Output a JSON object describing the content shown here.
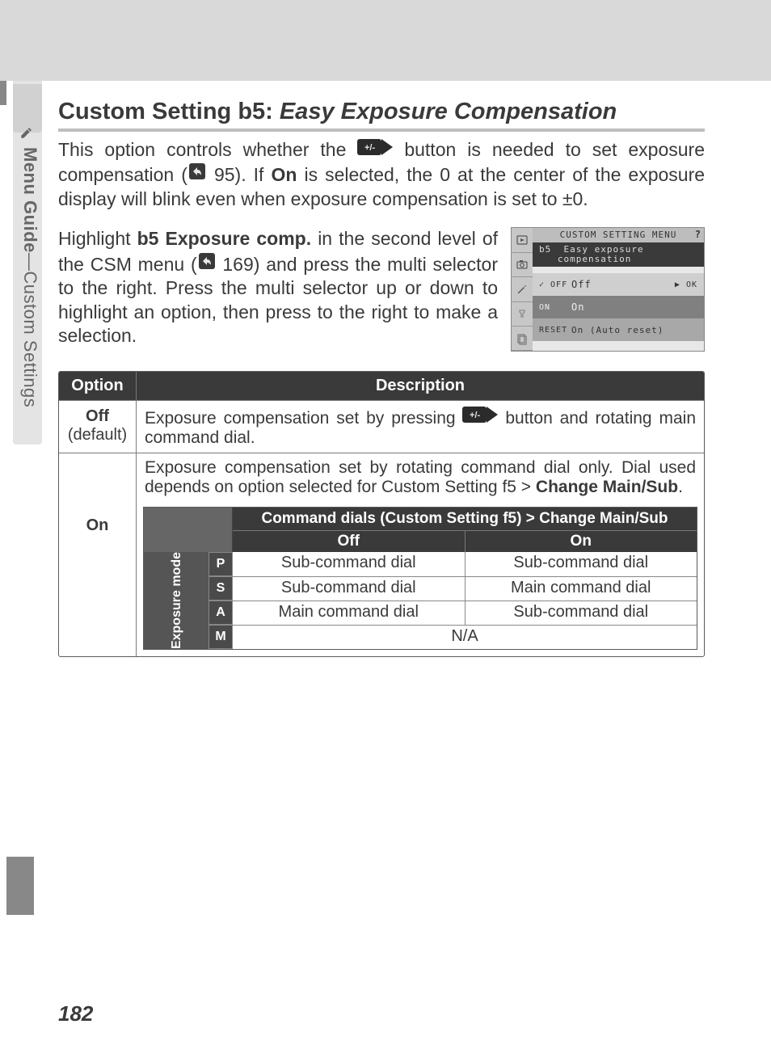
{
  "side_tab": {
    "icon": "pencil-icon",
    "label_bold": "Menu Guide",
    "label_sep": "—",
    "label_rest": "Custom Settings"
  },
  "heading": {
    "lead": "Custom Setting b5:",
    "title": "Easy Exposure Compensation"
  },
  "intro": {
    "p1a": "This option controls whether the",
    "p1b": "button is needed to set exposure compensation (",
    "xref1": "95",
    "p1c": ").  If",
    "p1bold": "On",
    "p1d": "is selected, the 0 at the center of the exposure display will blink even when exposure compensation is set to ±0."
  },
  "para2": {
    "a": "Highlight",
    "bold": "b5 Exposure comp.",
    "b": "in the second level of the CSM menu (",
    "xref": "169",
    "c": ") and press the multi selector to the right.  Press the multi selector up or down to highlight an option, then press to the right to make a selection."
  },
  "camera_menu": {
    "title": "CUSTOM SETTING MENU",
    "header_line1": "b5",
    "header_line2": "Easy exposure",
    "header_line3": "compensation",
    "opt1_tag": "✓ OFF",
    "opt1_label": "Off",
    "opt1_ok": "▶ OK",
    "opt2_tag": "ON",
    "opt2_label": "On",
    "opt3_tag": "RESET",
    "opt3_label": "On (Auto reset)"
  },
  "table": {
    "hdr_option": "Option",
    "hdr_desc": "Description",
    "off_label": "Off",
    "off_sub": "(default)",
    "off_desc_a": "Exposure compensation set by pressing",
    "off_desc_b": "button and rotating main command dial.",
    "on_label": "On",
    "on_desc": "Exposure compensation set by rotating command dial only.  Dial used depends on option selected for Custom Setting f5 >",
    "on_desc_bold": "Change Main/Sub",
    "on_desc_end": "."
  },
  "dial_table": {
    "title": "Command dials (Custom Setting f5) > Change Main/Sub",
    "col_off": "Off",
    "col_on": "On",
    "row_label": "Exposure mode",
    "modes": [
      "P",
      "S",
      "A",
      "M"
    ],
    "rows": [
      {
        "off": "Sub-command dial",
        "on": "Sub-command dial"
      },
      {
        "off": "Sub-command dial",
        "on": "Main command dial"
      },
      {
        "off": "Main command dial",
        "on": "Sub-command dial"
      },
      {
        "span": "N/A"
      }
    ]
  },
  "page_number": "182"
}
